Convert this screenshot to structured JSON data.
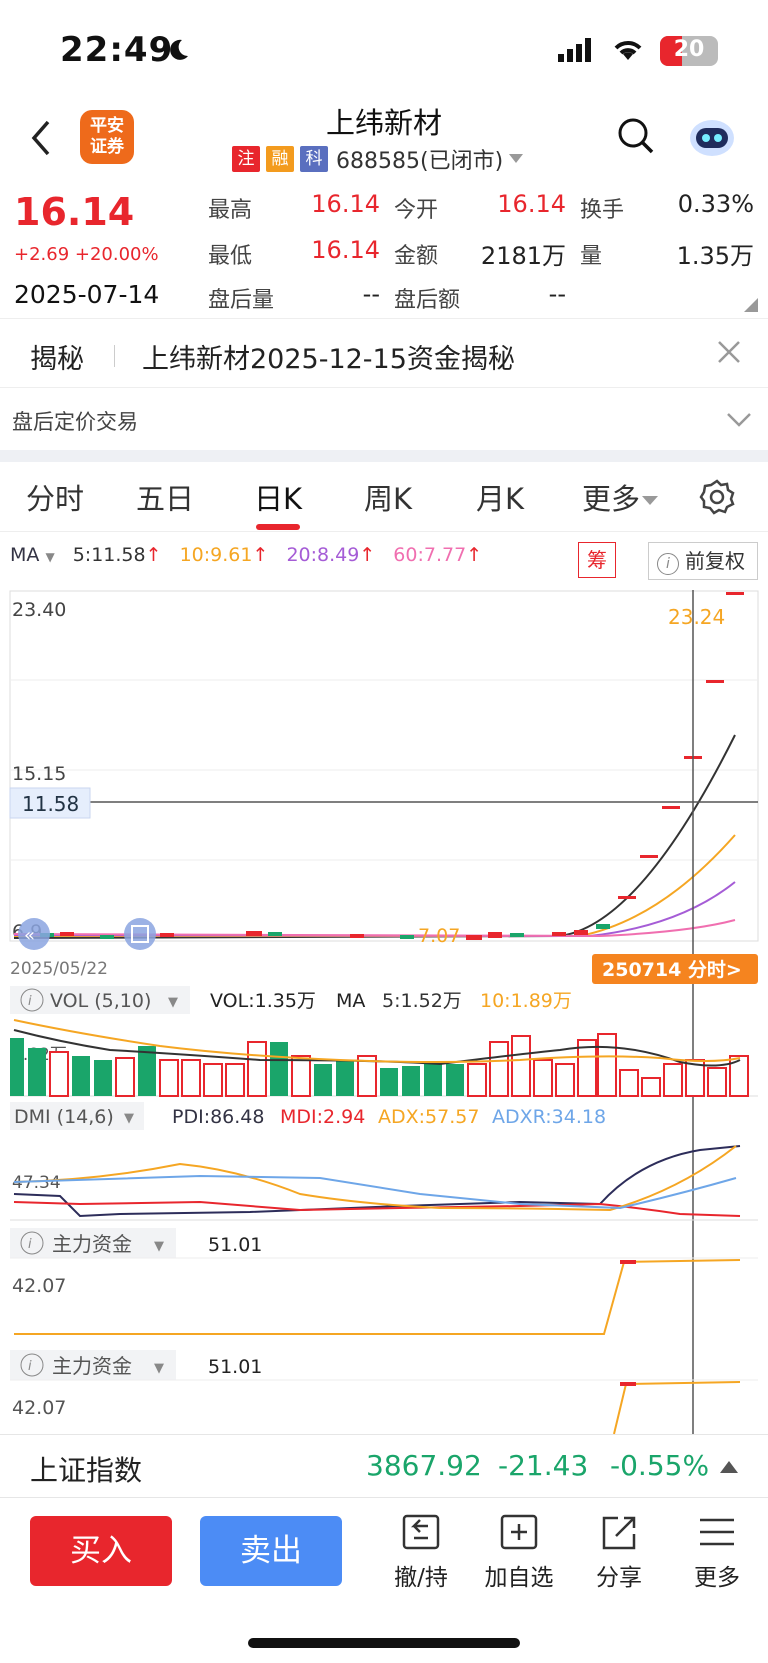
{
  "status_bar": {
    "time": "22:49",
    "battery": "20"
  },
  "header": {
    "logo_line1": "平安",
    "logo_line2": "证券",
    "stock_name": "上纬新材",
    "tags": [
      {
        "text": "注",
        "color": "#e8262d"
      },
      {
        "text": "融",
        "color": "#f39b1e"
      },
      {
        "text": "科",
        "color": "#5a6fbf"
      }
    ],
    "code_status": "688585(已闭市)"
  },
  "quote": {
    "price": "16.14",
    "change": "+2.69 +20.00%",
    "date": "2025-07-14",
    "high_label": "最高",
    "high": "16.14",
    "open_label": "今开",
    "open": "16.14",
    "turnover_label": "换手",
    "turnover": "0.33%",
    "low_label": "最低",
    "low": "16.14",
    "amount_label": "金额",
    "amount": "2181万",
    "volume_label": "量",
    "volume": "1.35万",
    "ah_vol_label": "盘后量",
    "ah_vol": "--",
    "ah_amt_label": "盘后额",
    "ah_amt": "--"
  },
  "reveal": {
    "label": "揭秘",
    "text": "上纬新材2025-12-15资金揭秘"
  },
  "afterhours": {
    "text": "盘后定价交易"
  },
  "tabs": [
    {
      "label": "分时"
    },
    {
      "label": "五日"
    },
    {
      "label": "日K"
    },
    {
      "label": "周K"
    },
    {
      "label": "月K"
    },
    {
      "label": "更多"
    }
  ],
  "ma": {
    "label": "MA",
    "ma5": "5:11.58",
    "ma10": "10:9.61",
    "ma20": "20:8.49",
    "ma60": "60:7.77",
    "chou": "筹",
    "fuquan": "前复权"
  },
  "colors": {
    "up": "#e8262d",
    "down": "#1aa56a",
    "ma5": "#333333",
    "ma10": "#f5a623",
    "ma20": "#a55cd6",
    "ma60": "#f06fb0",
    "adxr": "#6ea6e8"
  },
  "kchart": {
    "y_top": "23.40",
    "y_mid": "15.15",
    "y_low": "6.9",
    "crosshair_price": "11.58",
    "max_label": "23.24",
    "min_label": "7.07",
    "start_date": "2025/05/22",
    "tooltip": "250714 分时>"
  },
  "vol": {
    "label": "VOL (5,10)",
    "vol": "VOL:1.35万",
    "ma_label": "MA",
    "ma5": "5:1.52万",
    "ma10": "10:1.89万",
    "axis": "1.82万"
  },
  "dmi": {
    "label": "DMI (14,6)",
    "pdi": "PDI:86.48",
    "mdi": "MDI:2.94",
    "adx": "ADX:57.57",
    "adxr": "ADXR:34.18",
    "axis": "47.34"
  },
  "funds1": {
    "label": "主力资金",
    "value": "51.01",
    "axis": "42.07"
  },
  "funds2": {
    "label": "主力资金",
    "value": "51.01",
    "axis": "42.07"
  },
  "index": {
    "name": "上证指数",
    "value": "3867.92",
    "change": "-21.43",
    "pct": "-0.55%"
  },
  "toolbar": {
    "buy": "买入",
    "sell": "卖出",
    "cancel": "撤/持",
    "add": "加自选",
    "share": "分享",
    "more": "更多"
  }
}
